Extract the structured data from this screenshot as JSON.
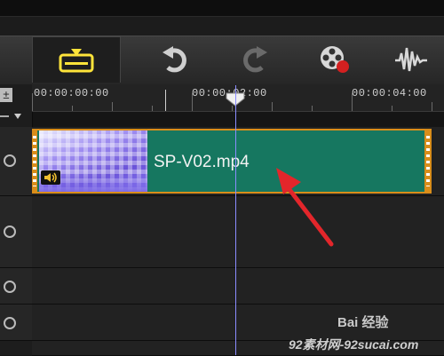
{
  "ruler": {
    "timecodes": [
      "00:00:00:00",
      "00:00:02:00",
      "00:00:04:00"
    ]
  },
  "clip": {
    "label": "SP-V02.mp4"
  },
  "watermark": {
    "top": "Bai 经验",
    "bottom": "92素材网-92sucai.com"
  },
  "icons": {
    "toolbar": [
      "timeline-view-icon",
      "undo-icon",
      "redo-icon",
      "record-icon",
      "audio-wave-icon"
    ],
    "tracks": [
      "film-reel-icon",
      "film-reel-icon",
      "film-reel-icon",
      "film-reel-icon"
    ]
  },
  "colors": {
    "clip_fill": "#167760",
    "clip_border": "#d98d1a",
    "playhead": "#8a8cff",
    "active_toolbar_icon": "#ffe43a",
    "arrow": "#e3262b"
  }
}
